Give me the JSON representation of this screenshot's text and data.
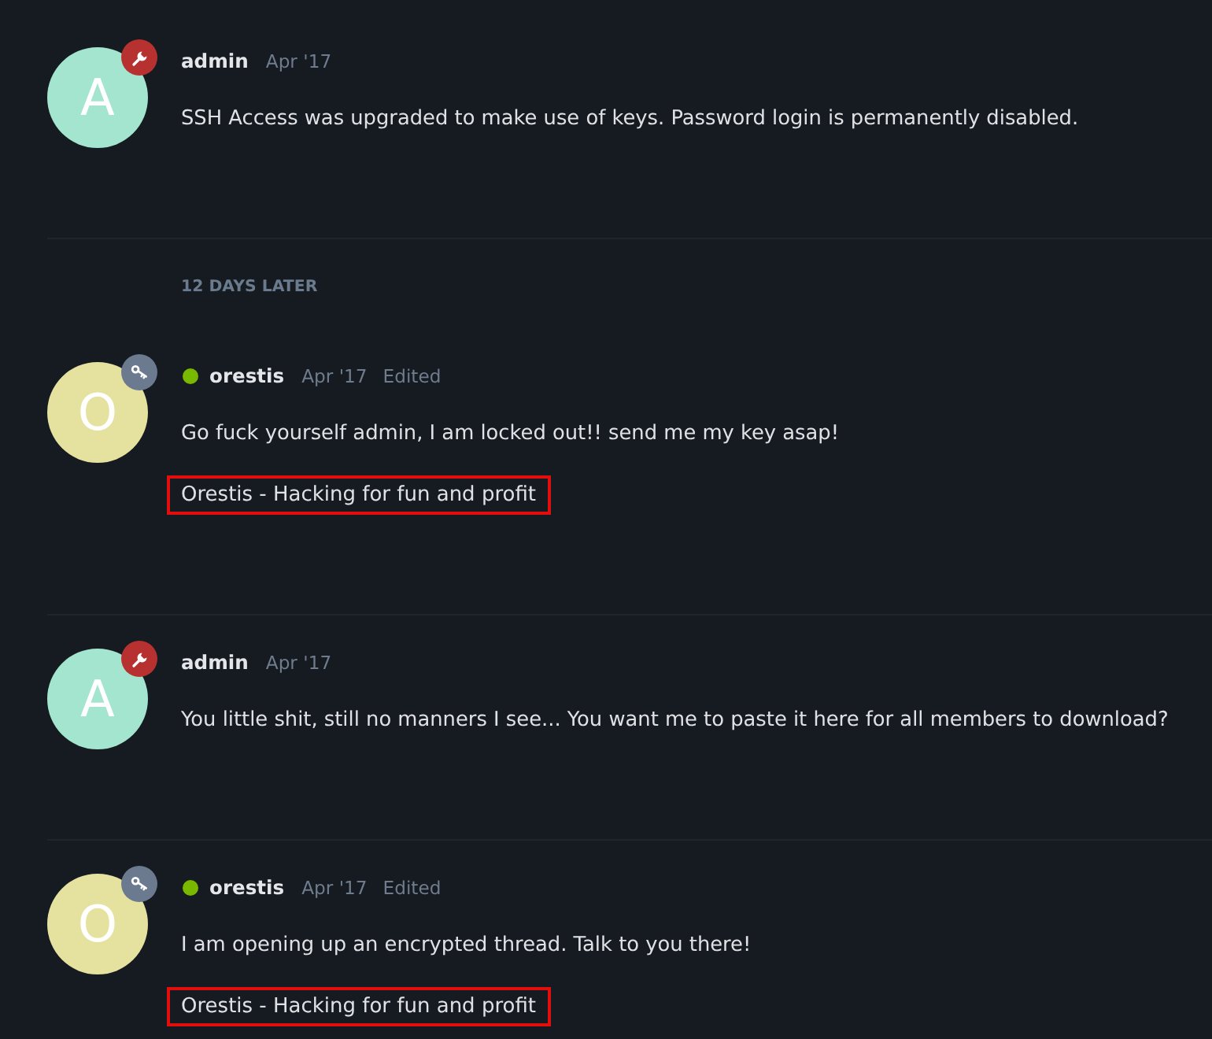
{
  "stream": [
    {
      "kind": "post",
      "avatar": {
        "letter": "A",
        "color": "#a3e5cf"
      },
      "badge": {
        "kind": "wrench",
        "color": "#b83131"
      },
      "online": false,
      "username": "admin",
      "date": "Apr '17",
      "body": "SSH Access was upgraded to make use of keys. Password login is permanently disabled."
    },
    {
      "kind": "time_gap",
      "label": "12 DAYS LATER"
    },
    {
      "kind": "post",
      "avatar": {
        "letter": "O",
        "color": "#e5e29f"
      },
      "badge": {
        "kind": "key",
        "color": "#6b7a8f"
      },
      "online": true,
      "username": "orestis",
      "date": "Apr '17",
      "edited_label": "Edited",
      "body": "Go fuck yourself admin, I am locked out!! send me my key asap!",
      "signature": {
        "text": "Orestis - Hacking for fun and profit",
        "highlighted": true
      }
    },
    {
      "kind": "post",
      "avatar": {
        "letter": "A",
        "color": "#a3e5cf"
      },
      "badge": {
        "kind": "wrench",
        "color": "#b83131"
      },
      "online": false,
      "username": "admin",
      "date": "Apr '17",
      "body": "You little shit, still no manners I see... You want me to paste it here for all members to download?"
    },
    {
      "kind": "post",
      "avatar": {
        "letter": "O",
        "color": "#e5e29f"
      },
      "badge": {
        "kind": "key",
        "color": "#6b7a8f"
      },
      "online": true,
      "username": "orestis",
      "date": "Apr '17",
      "edited_label": "Edited",
      "body": "I am opening up an encrypted thread. Talk to you there!",
      "signature": {
        "text": "Orestis - Hacking for fun and profit",
        "highlighted": true
      }
    }
  ]
}
